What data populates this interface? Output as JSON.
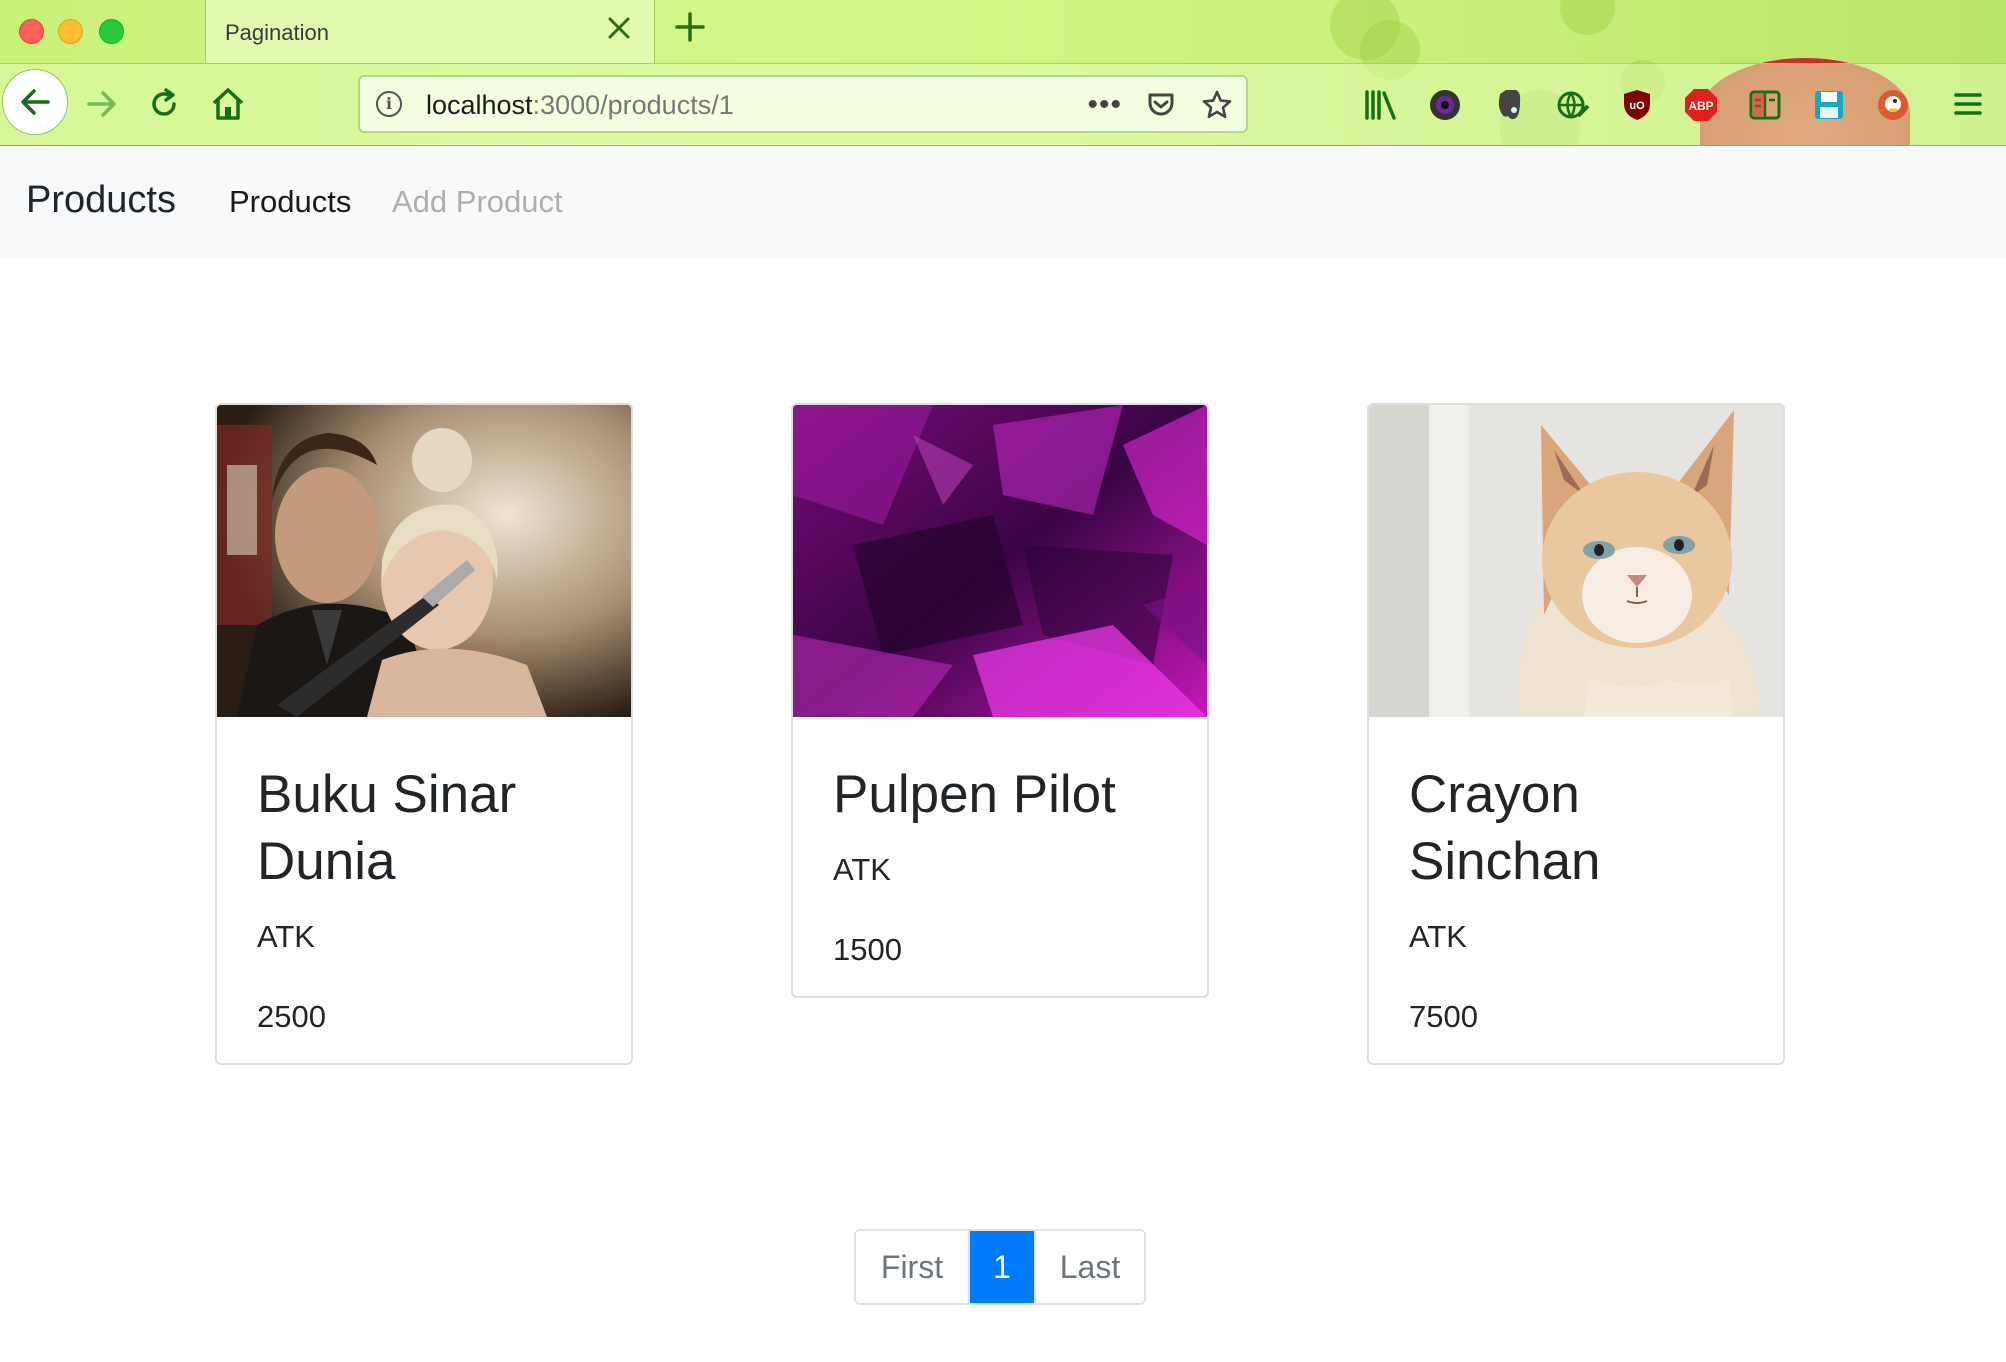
{
  "browser": {
    "tab_title": "Pagination",
    "url_host": "localhost",
    "url_path": ":3000/products/1"
  },
  "site": {
    "brand": "Products",
    "nav": [
      {
        "label": "Products",
        "state": "active"
      },
      {
        "label": "Add Product",
        "state": "muted"
      }
    ]
  },
  "products": [
    {
      "title": "Buku Sinar Dunia",
      "category": "ATK",
      "price": "2500",
      "image": "couple-photo"
    },
    {
      "title": "Pulpen Pilot",
      "category": "ATK",
      "price": "1500",
      "image": "purple-abstract"
    },
    {
      "title": "Crayon Sinchan",
      "category": "ATK",
      "price": "7500",
      "image": "cat-photo"
    }
  ],
  "pagination": {
    "first_label": "First",
    "current_page": "1",
    "last_label": "Last"
  },
  "colors": {
    "primary": "#007bff",
    "chrome_green": "#d5f788"
  }
}
